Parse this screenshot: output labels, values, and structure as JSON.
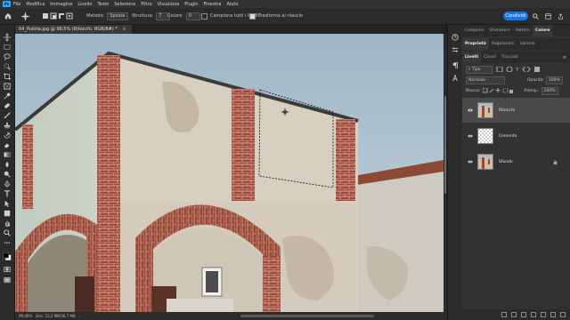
{
  "app": {
    "logo_text": "Ps"
  },
  "menubar": {
    "items": [
      "File",
      "Modifica",
      "Immagine",
      "Livello",
      "Testo",
      "Selezione",
      "Filtro",
      "Visualizza",
      "Plugin",
      "Finestra",
      "Aiuto"
    ]
  },
  "options": {
    "metodo_label": "Metodo:",
    "metodo_value": "Sposta",
    "struttura_label": "Struttura:",
    "struttura_value": "7",
    "colore_label": "Colore:",
    "colore_value": "0",
    "campiona_label": "Campiona tutti i livelli",
    "campiona_checked": false,
    "trasforma_label": "Trasforma al rilascio",
    "trasforma_checked": true,
    "share_label": "Condividi"
  },
  "document": {
    "tab_title": "04_Pulizia.jpg @ 99,5% (Ritocchi, RGB/8#) *"
  },
  "status": {
    "zoom": "99,46%",
    "doc_size": "Doc: 22,2 MB/36,7 MB"
  },
  "panels": {
    "top_tabs": [
      "Campioni",
      "Sfumature",
      "Pattern",
      "Colore"
    ],
    "top_active": "Colore",
    "mid_tabs": [
      "Proprietà",
      "Regolazioni",
      "Librerie"
    ],
    "mid_active": "Proprietà",
    "layer_tabs": [
      "Livelli",
      "Canali",
      "Tracciati"
    ],
    "layer_active": "Livelli",
    "filter_kind": "Tipo",
    "blend_mode": "Normale",
    "opacity_label": "Opacità:",
    "opacity_value": "100%",
    "lock_label": "Blocca:",
    "fill_label": "Riemp.:",
    "fill_value": "100%",
    "layers": [
      {
        "name": "Ritocchi",
        "selected": true,
        "locked": false
      },
      {
        "name": "Cemento",
        "selected": false,
        "locked": false
      },
      {
        "name": "Sfondo",
        "selected": false,
        "locked": true
      }
    ]
  },
  "colors": {
    "accent": "#1473e6",
    "sky": "#b4c7d4",
    "brick": "#9c4635",
    "plaster": "#d4cbbd"
  },
  "icons": {
    "toolbar": [
      "move-icon",
      "marquee-icon",
      "lasso-icon",
      "quick-select-icon",
      "crop-icon",
      "frame-icon",
      "eyedropper-icon",
      "healing-brush-icon",
      "brush-icon",
      "clone-stamp-icon",
      "history-brush-icon",
      "eraser-icon",
      "gradient-icon",
      "blur-icon",
      "dodge-icon",
      "pen-icon",
      "type-icon",
      "path-select-icon",
      "shape-icon",
      "hand-icon",
      "zoom-icon",
      "more-tools-icon",
      "color-swatches-icon",
      "quick-mask-icon",
      "screen-mode-icon"
    ]
  }
}
